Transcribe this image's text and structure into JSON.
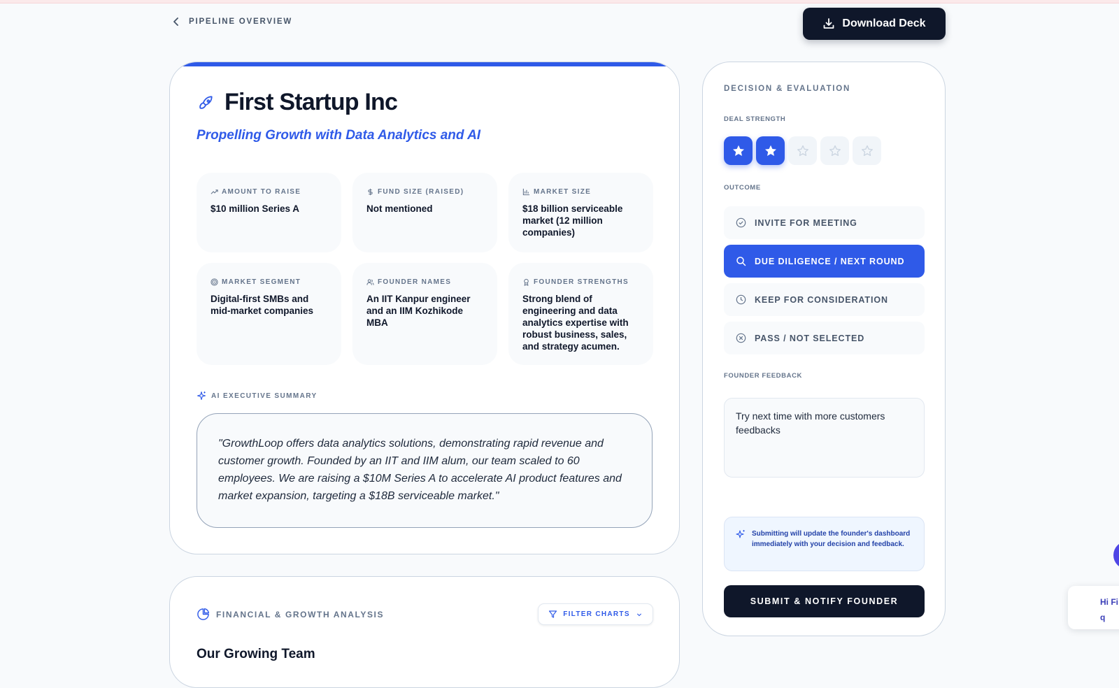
{
  "nav": {
    "back_label": "PIPELINE OVERVIEW",
    "download_label": "Download Deck"
  },
  "startup": {
    "name": "First Startup Inc",
    "tagline": "Propelling Growth with Data Analytics and AI"
  },
  "metrics": [
    {
      "label": "AMOUNT TO RAISE",
      "value": "$10 million Series A",
      "icon": "trending-up-icon"
    },
    {
      "label": "FUND SIZE (RAISED)",
      "value": "Not mentioned",
      "icon": "dollar-icon"
    },
    {
      "label": "MARKET SIZE",
      "value": "$18 billion serviceable market (12 million companies)",
      "icon": "bar-chart-icon"
    },
    {
      "label": "MARKET SEGMENT",
      "value": "Digital-first SMBs and mid-market companies",
      "icon": "target-icon"
    },
    {
      "label": "FOUNDER NAMES",
      "value": "An IIT Kanpur engineer and an IIM Kozhikode MBA",
      "icon": "users-icon"
    },
    {
      "label": "FOUNDER STRENGTHS",
      "value": "Strong blend of engineering and data analytics expertise with robust business, sales, and strategy acumen.",
      "icon": "award-icon"
    }
  ],
  "summary": {
    "label": "AI EXECUTIVE SUMMARY",
    "text": "\"GrowthLoop offers data analytics solutions, demonstrating rapid revenue and customer growth. Founded by an IIT and IIM alum, our team scaled to 60 employees. We are raising a $10M Series A to accelerate AI product features and market expansion, targeting a $18B serviceable market.\""
  },
  "financial": {
    "label": "FINANCIAL & GROWTH ANALYSIS",
    "filter_label": "FILTER CHARTS",
    "section_heading": "Our Growing Team"
  },
  "panel": {
    "title": "DECISION & EVALUATION",
    "deal_strength_label": "DEAL STRENGTH",
    "deal_strength_rating": 2,
    "deal_strength_max": 5,
    "outcome_label": "OUTCOME",
    "outcomes": [
      {
        "label": "INVITE FOR MEETING",
        "icon": "check-circle-icon",
        "selected": false
      },
      {
        "label": "DUE DILIGENCE / NEXT ROUND",
        "icon": "search-icon",
        "selected": true
      },
      {
        "label": "KEEP FOR CONSIDERATION",
        "icon": "clock-icon",
        "selected": false
      },
      {
        "label": "PASS / NOT SELECTED",
        "icon": "x-circle-icon",
        "selected": false
      }
    ],
    "feedback_label": "FOUNDER FEEDBACK",
    "feedback_value": "Try next time with more customers feedbacks",
    "notice_text": "Submitting will update the founder's dashboard immediately with your decision and feedback.",
    "submit_label": "SUBMIT & NOTIFY FOUNDER"
  },
  "chat": {
    "line1": "Hi Fi",
    "line2": "q"
  },
  "colors": {
    "accent": "#2f5ae8",
    "dark": "#0f172a",
    "muted": "#64748b"
  }
}
